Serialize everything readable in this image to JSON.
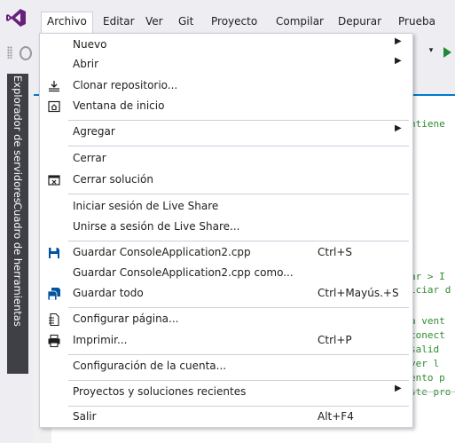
{
  "menubar": {
    "items": [
      "Archivo",
      "Editar",
      "Ver",
      "Git",
      "Proyecto",
      "Compilar",
      "Depurar",
      "Prueba"
    ]
  },
  "sidetabs": {
    "server_explorer": "Explorador de servidores",
    "toolbox": "Cuadro de herramientas"
  },
  "editor": {
    "lines": [
      "ntiene",
      "ar > I",
      "iciar d",
      "a vent",
      "conect",
      "salid",
      "ver l",
      "ento p",
      "ste pro"
    ]
  },
  "file_menu": {
    "items": [
      {
        "label": "Nuevo",
        "shortcut": "",
        "submenu": true,
        "icon": ""
      },
      {
        "label": "Abrir",
        "shortcut": "",
        "submenu": true,
        "icon": ""
      },
      {
        "label": "Clonar repositorio...",
        "shortcut": "",
        "submenu": false,
        "icon": "clone-repo-icon"
      },
      {
        "label": "Ventana de inicio",
        "shortcut": "",
        "submenu": false,
        "icon": "start-window-icon"
      },
      {
        "label": "Agregar",
        "shortcut": "",
        "submenu": true,
        "icon": ""
      },
      {
        "label": "Cerrar",
        "shortcut": "",
        "submenu": false,
        "icon": ""
      },
      {
        "label": "Cerrar solución",
        "shortcut": "",
        "submenu": false,
        "icon": "close-solution-icon"
      },
      {
        "label": "Iniciar sesión de Live Share",
        "shortcut": "",
        "submenu": false,
        "icon": ""
      },
      {
        "label": "Unirse a sesión de Live Share...",
        "shortcut": "",
        "submenu": false,
        "icon": ""
      },
      {
        "label": "Guardar ConsoleApplication2.cpp",
        "shortcut": "Ctrl+S",
        "submenu": false,
        "icon": "save-icon"
      },
      {
        "label": "Guardar ConsoleApplication2.cpp como...",
        "shortcut": "",
        "submenu": false,
        "icon": ""
      },
      {
        "label": "Guardar todo",
        "shortcut": "Ctrl+Mayús.+S",
        "submenu": false,
        "icon": "save-all-icon"
      },
      {
        "label": "Configurar página...",
        "shortcut": "",
        "submenu": false,
        "icon": "page-setup-icon"
      },
      {
        "label": "Imprimir...",
        "shortcut": "Ctrl+P",
        "submenu": false,
        "icon": "print-icon"
      },
      {
        "label": "Configuración de la cuenta...",
        "shortcut": "",
        "submenu": false,
        "icon": ""
      },
      {
        "label": "Proyectos y soluciones recientes",
        "shortcut": "",
        "submenu": true,
        "icon": ""
      },
      {
        "label": "Salir",
        "shortcut": "Alt+F4",
        "submenu": false,
        "icon": ""
      }
    ]
  },
  "colors": {
    "accent": "#007acc",
    "vs_purple": "#68217a",
    "code_comment": "#2f8c2f",
    "sidetab_bg": "#3f3f46"
  }
}
